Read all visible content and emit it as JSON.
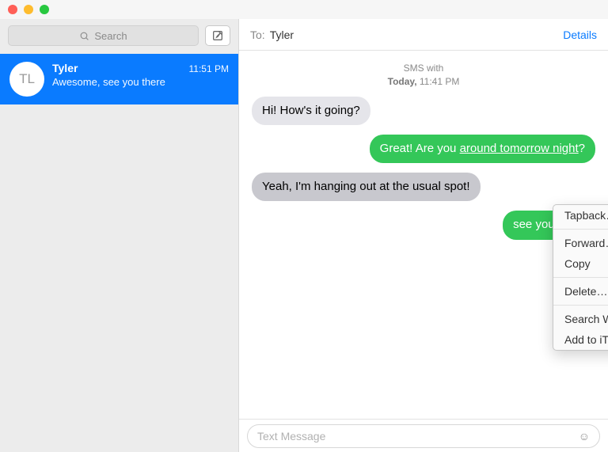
{
  "sidebar": {
    "search_placeholder": "Search",
    "conversation": {
      "initials": "TL",
      "name": "Tyler",
      "time": "11:51 PM",
      "preview": "Awesome, see you there"
    }
  },
  "header": {
    "to_label": "To:",
    "to_name": "Tyler",
    "details": "Details"
  },
  "status": {
    "line1": "SMS with",
    "line2_prefix": "Today,",
    "line2_time": "11:41 PM"
  },
  "messages": {
    "m1": "Hi! How's it going?",
    "m2_a": "Great! Are you ",
    "m2_b": "around tomorrow night",
    "m2_c": "?",
    "m3": "Yeah, I'm hanging out at the usual spot!",
    "m4": "see you there"
  },
  "context_menu": {
    "tapback": "Tapback…",
    "forward": "Forward…",
    "copy": "Copy",
    "delete": "Delete…",
    "search_google": "Search With Google",
    "add_itunes": "Add to iTunes as a Spoken Track"
  },
  "input": {
    "placeholder": "Text Message"
  }
}
